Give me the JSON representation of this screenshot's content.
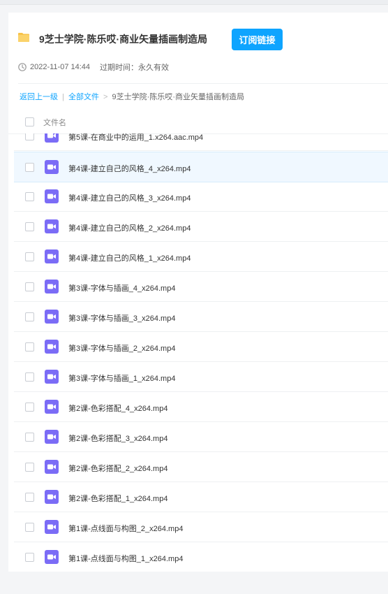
{
  "share": {
    "title": "9芝士学院·陈乐哎·商业矢量插画制造局",
    "subscribe_label": "订阅链接",
    "date": "2022-11-07 14:44",
    "expire": "过期时间：永久有效",
    "folder_icon": "folder-icon",
    "clock_icon": "clock-icon"
  },
  "breadcrumb": {
    "back": "返回上一级",
    "sep1": "|",
    "all_files": "全部文件",
    "sep2": ">",
    "current": "9芝士学院·陈乐哎·商业矢量插画制造局"
  },
  "table": {
    "header_name": "文件名"
  },
  "colors": {
    "accent": "#0ea4ff",
    "video_icon": "#7b6cf6"
  },
  "files": [
    {
      "name": "第5课-在商业中的运用_1.x264.aac.mp4",
      "icon": "video-icon"
    },
    {
      "name": "第4课-建立自己的风格_4_x264.mp4",
      "icon": "video-icon"
    },
    {
      "name": "第4课-建立自己的风格_3_x264.mp4",
      "icon": "video-icon"
    },
    {
      "name": "第4课-建立自己的风格_2_x264.mp4",
      "icon": "video-icon"
    },
    {
      "name": "第4课-建立自己的风格_1_x264.mp4",
      "icon": "video-icon"
    },
    {
      "name": "第3课-字体与插画_4_x264.mp4",
      "icon": "video-icon"
    },
    {
      "name": "第3课-字体与插画_3_x264.mp4",
      "icon": "video-icon"
    },
    {
      "name": "第3课-字体与插画_2_x264.mp4",
      "icon": "video-icon"
    },
    {
      "name": "第3课-字体与插画_1_x264.mp4",
      "icon": "video-icon"
    },
    {
      "name": "第2课-色彩搭配_4_x264.mp4",
      "icon": "video-icon"
    },
    {
      "name": "第2课-色彩搭配_3_x264.mp4",
      "icon": "video-icon"
    },
    {
      "name": "第2课-色彩搭配_2_x264.mp4",
      "icon": "video-icon"
    },
    {
      "name": "第2课-色彩搭配_1_x264.mp4",
      "icon": "video-icon"
    },
    {
      "name": "第1课-点线面与构图_2_x264.mp4",
      "icon": "video-icon"
    },
    {
      "name": "第1课-点线面与构图_1_x264.mp4",
      "icon": "video-icon"
    }
  ]
}
